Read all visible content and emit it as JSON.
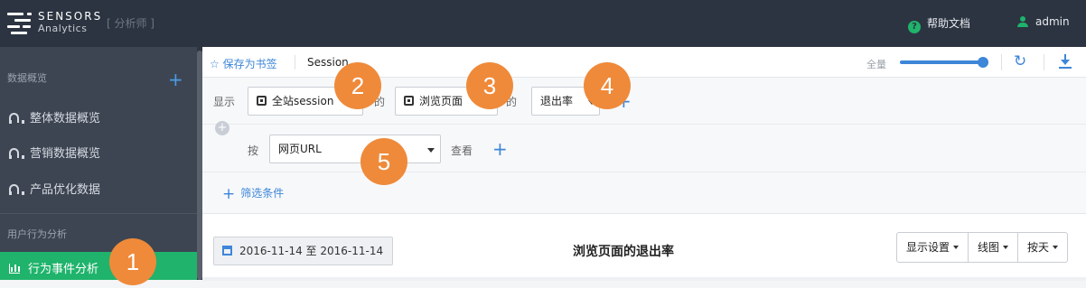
{
  "brand": {
    "name": "SENSORS",
    "sub": "Analytics",
    "role": "[ 分析师 ]"
  },
  "header": {
    "help": "帮助文档",
    "user": "admin"
  },
  "sidebar": {
    "section1": "数据概览",
    "items": [
      {
        "label": "整体数据概览"
      },
      {
        "label": "营销数据概览"
      },
      {
        "label": "产品优化数据"
      }
    ],
    "section2": "用户行为分析",
    "active": "行为事件分析"
  },
  "toolbar": {
    "bookmark": "保存为书签",
    "title": "Session",
    "zoom_label": "全量",
    "zoom_value": 1.0
  },
  "query": {
    "show_label": "显示",
    "session_select": "全站session",
    "of_text_1": "的",
    "event_select": "浏览页面",
    "of_text_2": "的",
    "metric_select": "退出率",
    "by_label": "按",
    "groupby_select": "网页URL",
    "view_label": "查看",
    "filter": "筛选条件"
  },
  "result": {
    "date_range": "2016-11-14 至 2016-11-14",
    "title": "浏览页面的退出率",
    "buttons": [
      "显示设置",
      "线图",
      "按天"
    ]
  },
  "badges": [
    "1",
    "2",
    "3",
    "4",
    "5"
  ]
}
